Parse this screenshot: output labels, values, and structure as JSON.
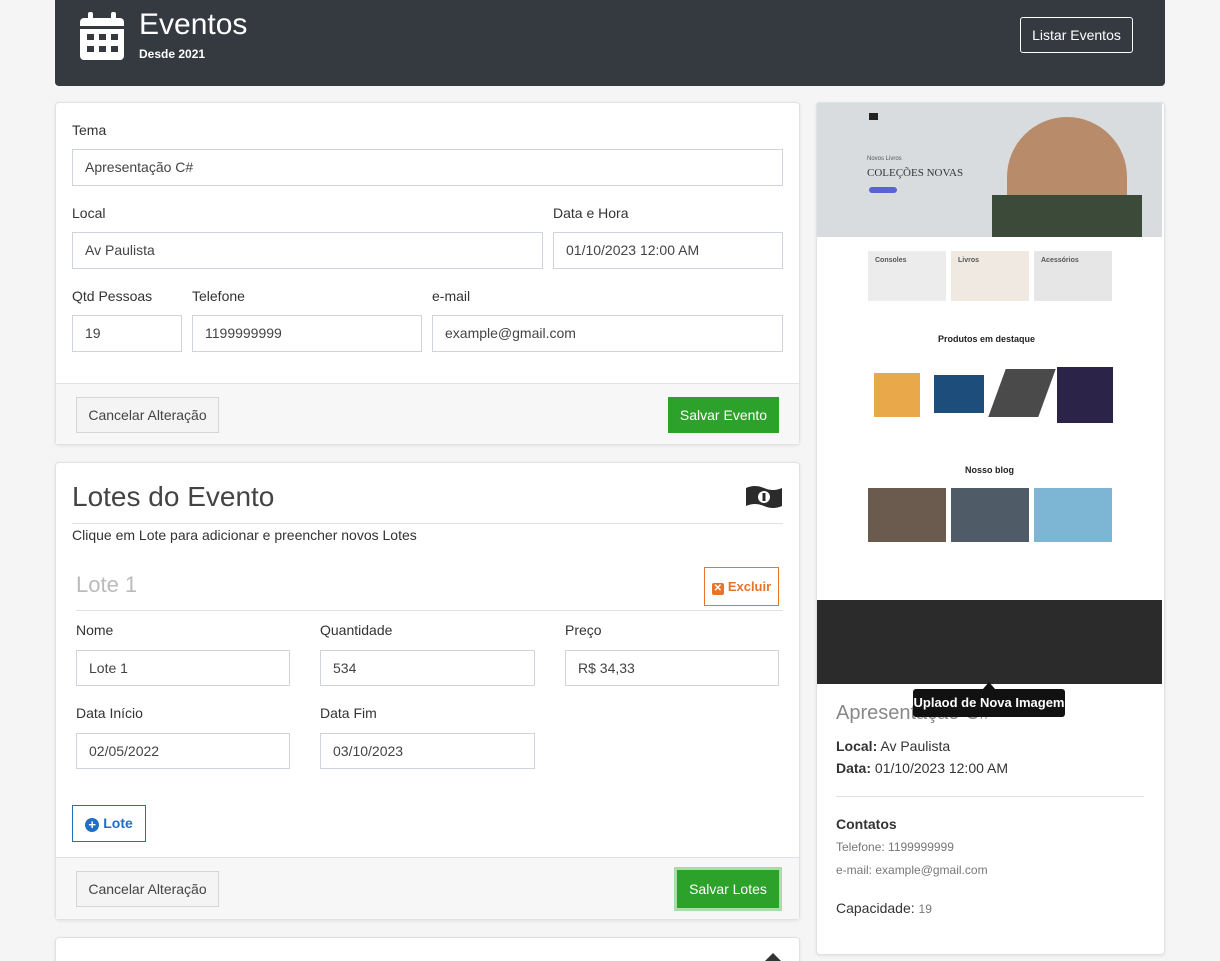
{
  "header": {
    "title": "Eventos",
    "subtitle": "Desde 2021",
    "list_button": "Listar Eventos"
  },
  "event_form": {
    "tema_label": "Tema",
    "tema_value": "Apresentação C#",
    "local_label": "Local",
    "local_value": "Av Paulista",
    "data_label": "Data e Hora",
    "data_value": "01/10/2023 12:00 AM",
    "qtd_label": "Qtd Pessoas",
    "qtd_value": "19",
    "telefone_label": "Telefone",
    "telefone_value": "1199999999",
    "email_label": "e-mail",
    "email_value": "example@gmail.com",
    "cancel_button": "Cancelar Alteração",
    "save_button": "Salvar Evento"
  },
  "lotes": {
    "title": "Lotes do Evento",
    "help": "Clique em Lote para adicionar e preencher novos Lotes",
    "lote_title": "Lote 1",
    "delete_button": "Excluir",
    "nome_label": "Nome",
    "nome_value": "Lote 1",
    "quantidade_label": "Quantidade",
    "quantidade_value": "534",
    "preco_label": "Preço",
    "preco_value": "R$ 34,33",
    "inicio_label": "Data Início",
    "inicio_value": "02/05/2022",
    "fim_label": "Data Fim",
    "fim_value": "03/10/2023",
    "add_button": "Lote",
    "cancel_button": "Cancelar Alteração",
    "save_button": "Salvar Lotes"
  },
  "preview": {
    "image": {
      "hero_small": "Novos Livros",
      "hero_title": "COLEÇÕES NOVAS",
      "cat1": "Consoles",
      "cat2": "Livros",
      "cat3": "Acessórios",
      "featured": "Produtos em destaque",
      "blog": "Nosso blog"
    },
    "tooltip": "Uplaod de Nova Imagem",
    "event_title": "Apresentação C#",
    "local_label": "Local:",
    "local_value": "Av Paulista",
    "data_label": "Data:",
    "data_value": "01/10/2023 12:00 AM",
    "contatos_label": "Contatos",
    "telefone": "Telefone: 1199999999",
    "email": "e-mail: example@gmail.com",
    "capacidade_label": "Capacidade:",
    "capacidade_value": "19"
  },
  "colors": {
    "header_bg": "#343a40",
    "success": "#2ca22a",
    "danger": "#e8742c",
    "primary": "#1f6fc5"
  }
}
